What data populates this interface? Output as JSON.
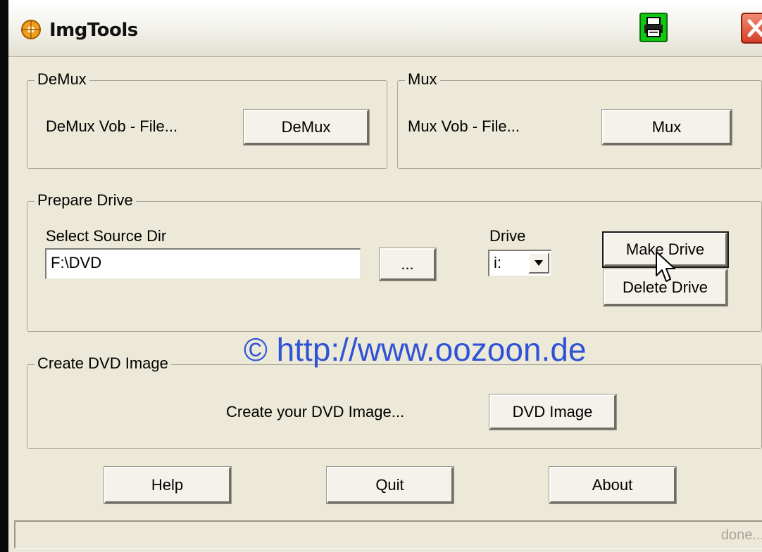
{
  "window": {
    "title": "ImgTools"
  },
  "demux": {
    "group_title": "DeMux",
    "description": "DeMux Vob - File...",
    "button_label": "DeMux"
  },
  "mux": {
    "group_title": "Mux",
    "description": "Mux Vob - File...",
    "button_label": "Mux"
  },
  "prepare_drive": {
    "group_title": "Prepare Drive",
    "source_label": "Select Source Dir",
    "source_value": "F:\\DVD",
    "browse_label": "...",
    "drive_label": "Drive",
    "drive_value": "i:",
    "make_drive_label": "Make Drive",
    "delete_drive_label": "Delete Drive"
  },
  "watermark": "© http://www.oozoon.de",
  "dvd_image": {
    "group_title": "Create DVD Image",
    "description": "Create your DVD Image...",
    "button_label": "DVD Image"
  },
  "footer": {
    "help_label": "Help",
    "quit_label": "Quit",
    "about_label": "About"
  },
  "status": {
    "text": "done..."
  },
  "colors": {
    "watermark": "#2f53d6",
    "printer_button": "#11c711",
    "close_button": "#d5402a"
  },
  "icons": {
    "app": "app-icon",
    "printer": "printer-icon",
    "close": "close-icon",
    "dropdown": "chevron-down-icon",
    "cursor": "mouse-cursor-icon"
  }
}
